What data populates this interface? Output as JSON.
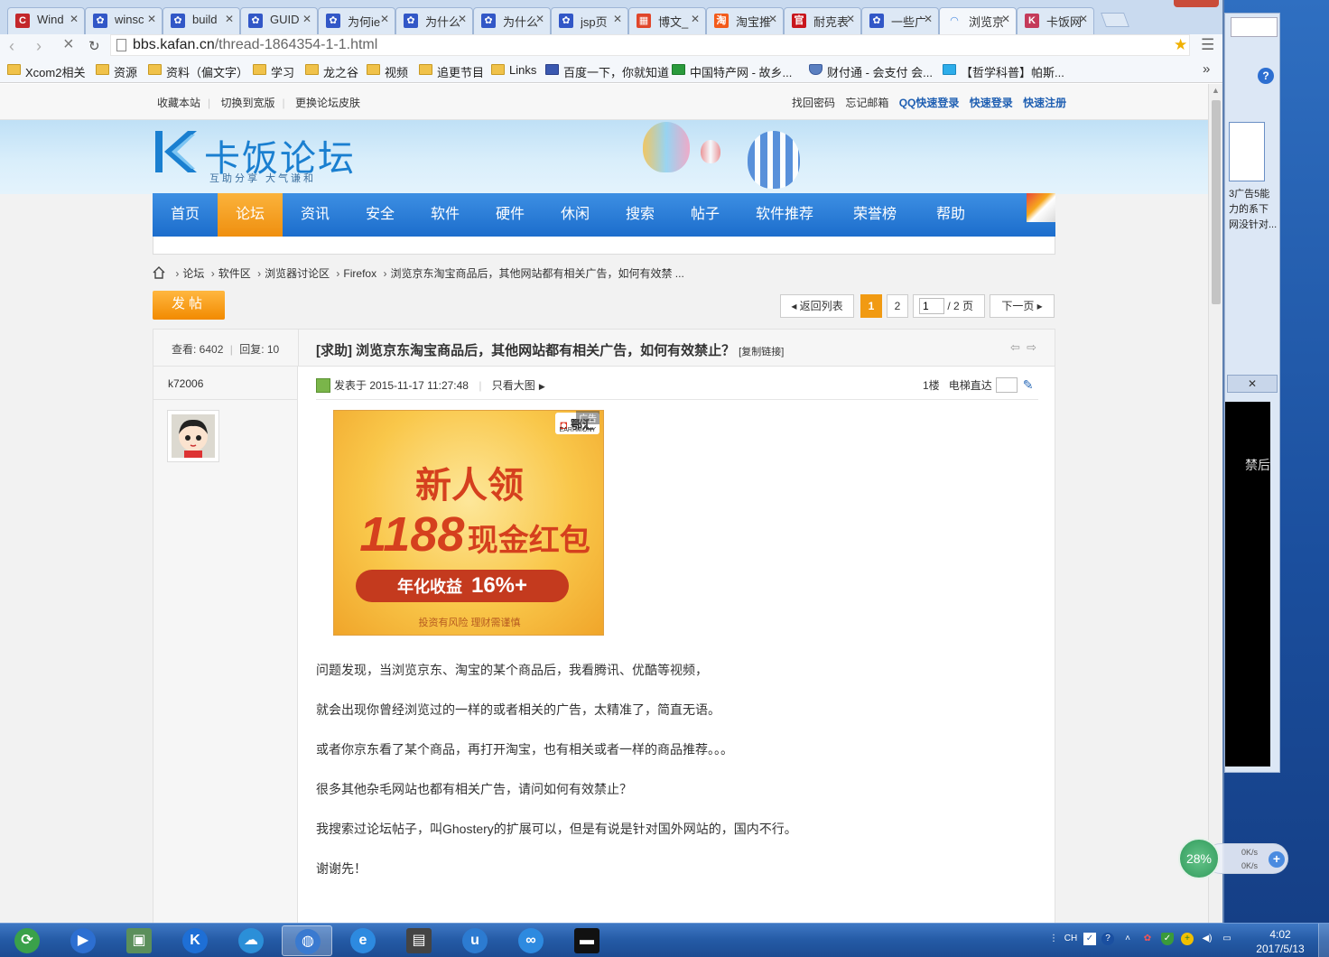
{
  "browser": {
    "tabs": [
      {
        "title": "Wind",
        "icon": "c-icon",
        "color": "#c3272b",
        "active": false
      },
      {
        "title": "winsc",
        "icon": "baidu-paw-icon",
        "color": "#3257c7",
        "active": false
      },
      {
        "title": "build",
        "icon": "baidu-paw-icon",
        "color": "#3257c7",
        "active": false
      },
      {
        "title": "GUID",
        "icon": "baidu-paw-icon",
        "color": "#3257c7",
        "active": false
      },
      {
        "title": "为何ie",
        "icon": "baidu-paw-icon",
        "color": "#3257c7",
        "active": false
      },
      {
        "title": "为什么",
        "icon": "baidu-paw-icon",
        "color": "#3257c7",
        "active": false
      },
      {
        "title": "为什么",
        "icon": "baidu-paw-icon",
        "color": "#3257c7",
        "active": false
      },
      {
        "title": "jsp页",
        "icon": "baidu-paw-icon",
        "color": "#3257c7",
        "active": false
      },
      {
        "title": "博文_",
        "icon": "colorful-icon",
        "color": "#e0462b",
        "active": false
      },
      {
        "title": "淘宝推",
        "icon": "taobao-icon",
        "color": "#f35b1b",
        "active": false
      },
      {
        "title": "耐克表",
        "icon": "official-icon",
        "color": "#c8161d",
        "active": false
      },
      {
        "title": "一些广",
        "icon": "baidu-paw-icon",
        "color": "#3257c7",
        "active": false
      },
      {
        "title": "浏览京",
        "icon": "loading-icon",
        "color": "#4a8be0",
        "active": true
      },
      {
        "title": "卡饭网",
        "icon": "kafan-icon",
        "color": "#c43a5a",
        "active": false
      }
    ],
    "url_host": "bbs.kafan.cn",
    "url_path": "/thread-1864354-1-1.html",
    "bookmarks": [
      {
        "label": "Xcom2相关",
        "type": "folder"
      },
      {
        "label": "资源",
        "type": "folder"
      },
      {
        "label": "资料（偏文字）",
        "type": "folder"
      },
      {
        "label": "学习",
        "type": "folder"
      },
      {
        "label": "龙之谷",
        "type": "folder"
      },
      {
        "label": "视频",
        "type": "folder"
      },
      {
        "label": "追更节目",
        "type": "folder"
      },
      {
        "label": "Links",
        "type": "folder"
      },
      {
        "label": "百度一下，你就知道",
        "type": "site"
      },
      {
        "label": "中国特产网 - 故乡...",
        "type": "green"
      },
      {
        "label": "财付通 - 会支付 会...",
        "type": "shield"
      },
      {
        "label": "【哲学科普】帕斯...",
        "type": "tv"
      }
    ]
  },
  "site": {
    "topbar_left": [
      "收藏本站",
      "切换到宽版",
      "更换论坛皮肤"
    ],
    "topbar_right": [
      "找回密码",
      "忘记邮箱",
      "QQ快速登录",
      "快速登录",
      "快速注册"
    ],
    "logo_text": "卡饭论坛",
    "logo_sub": "互助分享  大气谦和",
    "nav": [
      "首页",
      "论坛",
      "资讯",
      "安全",
      "软件",
      "硬件",
      "休闲",
      "搜索",
      "帖子",
      "软件推荐",
      "荣誉榜",
      "帮助"
    ],
    "nav_active": "论坛",
    "breadcrumb": [
      "论坛",
      "软件区",
      "浏览器讨论区",
      "Firefox",
      "浏览京东淘宝商品后，其他网站都有相关广告，如何有效禁 ..."
    ],
    "post_button": "发帖",
    "pager": {
      "back": "返回列表",
      "pages": [
        "1",
        "2"
      ],
      "current": "1",
      "input_value": "1",
      "total": "/ 2 页",
      "next": "下一页"
    }
  },
  "thread": {
    "views_label": "查看: 6402",
    "replies_label": "回复: 10",
    "title": "[求助] 浏览京东淘宝商品后，其他网站都有相关广告，如何有效禁止？",
    "copy_link": "[复制链接]",
    "author": "k72006",
    "posted": "发表于 2015-11-17 11:27:48",
    "only_big": "只看大图",
    "floor": "1楼",
    "elevator": "电梯直达",
    "ad": {
      "brand": "鄂汇",
      "brand_sub": "EARHMONY",
      "tag": "广告",
      "line1": "新人领",
      "amount": "1188",
      "cash": "现金红包",
      "yield_label": "年化收益",
      "yield_value": "16%+",
      "risk": "投资有风险  理财需谨慎"
    },
    "paragraphs": [
      "问题发现，当浏览京东、淘宝的某个商品后，我看腾讯、优酷等视频，",
      "就会出现你曾经浏览过的一样的或者相关的广告，太精准了，简直无语。",
      "或者你京东看了某个商品，再打开淘宝，也有相关或者一样的商品推荐。。。",
      "很多其他杂毛网站也都有相关广告，请问如何有效禁止？",
      "我搜索过论坛帖子，叫Ghostery的扩展可以，但是有说是针对国外网站的，国内不行。",
      "谢谢先！"
    ]
  },
  "desktop": {
    "bg_window_text": "3广告5能力的系下网没针对...",
    "bg_window_tail": "禁后"
  },
  "net_widget": {
    "percent": "28%",
    "up": "0K/s",
    "down": "0K/s"
  },
  "taskbar": {
    "items": [
      "start-orb",
      "media-player",
      "laptop-app",
      "kugou-k",
      "qq-cloud",
      "browser-globe",
      "internet-explorer",
      "book-reader",
      "ime-u",
      "baidu-cloud",
      "cmd-console"
    ],
    "active": "browser-globe",
    "clock_time": "4:02",
    "clock_date": "2017/5/13",
    "ime": "CH"
  }
}
